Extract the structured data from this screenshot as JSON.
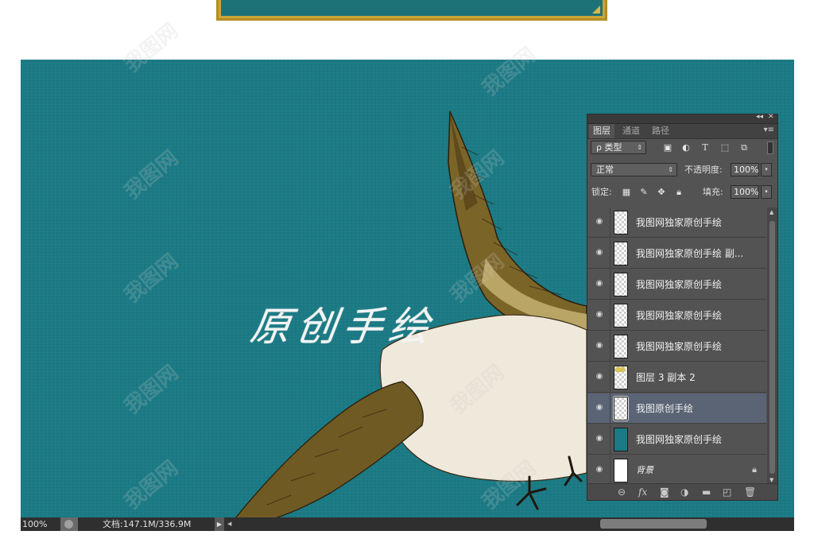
{
  "canvas": {
    "overlay_text": "原创手绘",
    "background_color": "#1a7a85"
  },
  "status_bar": {
    "zoom": "100%",
    "doc_info": "文档:147.1M/336.9M",
    "arrow": "▶",
    "scroll_left": "◀"
  },
  "layers_panel": {
    "title_controls": [
      "◂◂",
      "✕"
    ],
    "tabs": [
      {
        "label": "图层",
        "active": true
      },
      {
        "label": "通道",
        "active": false
      },
      {
        "label": "路径",
        "active": false
      }
    ],
    "menu_icon": "▾≡",
    "filter": {
      "label": "ρ 类型",
      "icons": [
        "image-filter-icon",
        "adjustment-filter-icon",
        "type-filter-icon",
        "shape-filter-icon",
        "smart-object-filter-icon"
      ]
    },
    "blend_mode": "正常",
    "opacity_label": "不透明度:",
    "opacity_value": "100%",
    "lock_label": "锁定:",
    "fill_label": "填充:",
    "fill_value": "100%",
    "layers": [
      {
        "name": "我图网独家原创手绘",
        "thumb": "transparent",
        "active": false
      },
      {
        "name": "我图网独家原创手绘 副...",
        "thumb": "transparent",
        "active": false
      },
      {
        "name": "我图网独家原创手绘",
        "thumb": "transparent",
        "active": false
      },
      {
        "name": "我图网独家原创手绘",
        "thumb": "transparent",
        "active": false
      },
      {
        "name": "我图网独家原创手绘",
        "thumb": "transparent",
        "active": false
      },
      {
        "name": "图层 3 副本 2",
        "thumb": "gold",
        "active": false
      },
      {
        "name": "我图原创手绘",
        "thumb": "selected",
        "active": true
      },
      {
        "name": "我图网独家原创手绘",
        "thumb": "teal",
        "active": false
      },
      {
        "name": "背景",
        "thumb": "white",
        "active": false,
        "locked": true
      }
    ],
    "bottom_icons": [
      "link-icon",
      "fx-icon",
      "mask-icon",
      "adjustment-icon",
      "group-icon",
      "new-layer-icon",
      "trash-icon"
    ]
  },
  "watermark_text": "我图网"
}
